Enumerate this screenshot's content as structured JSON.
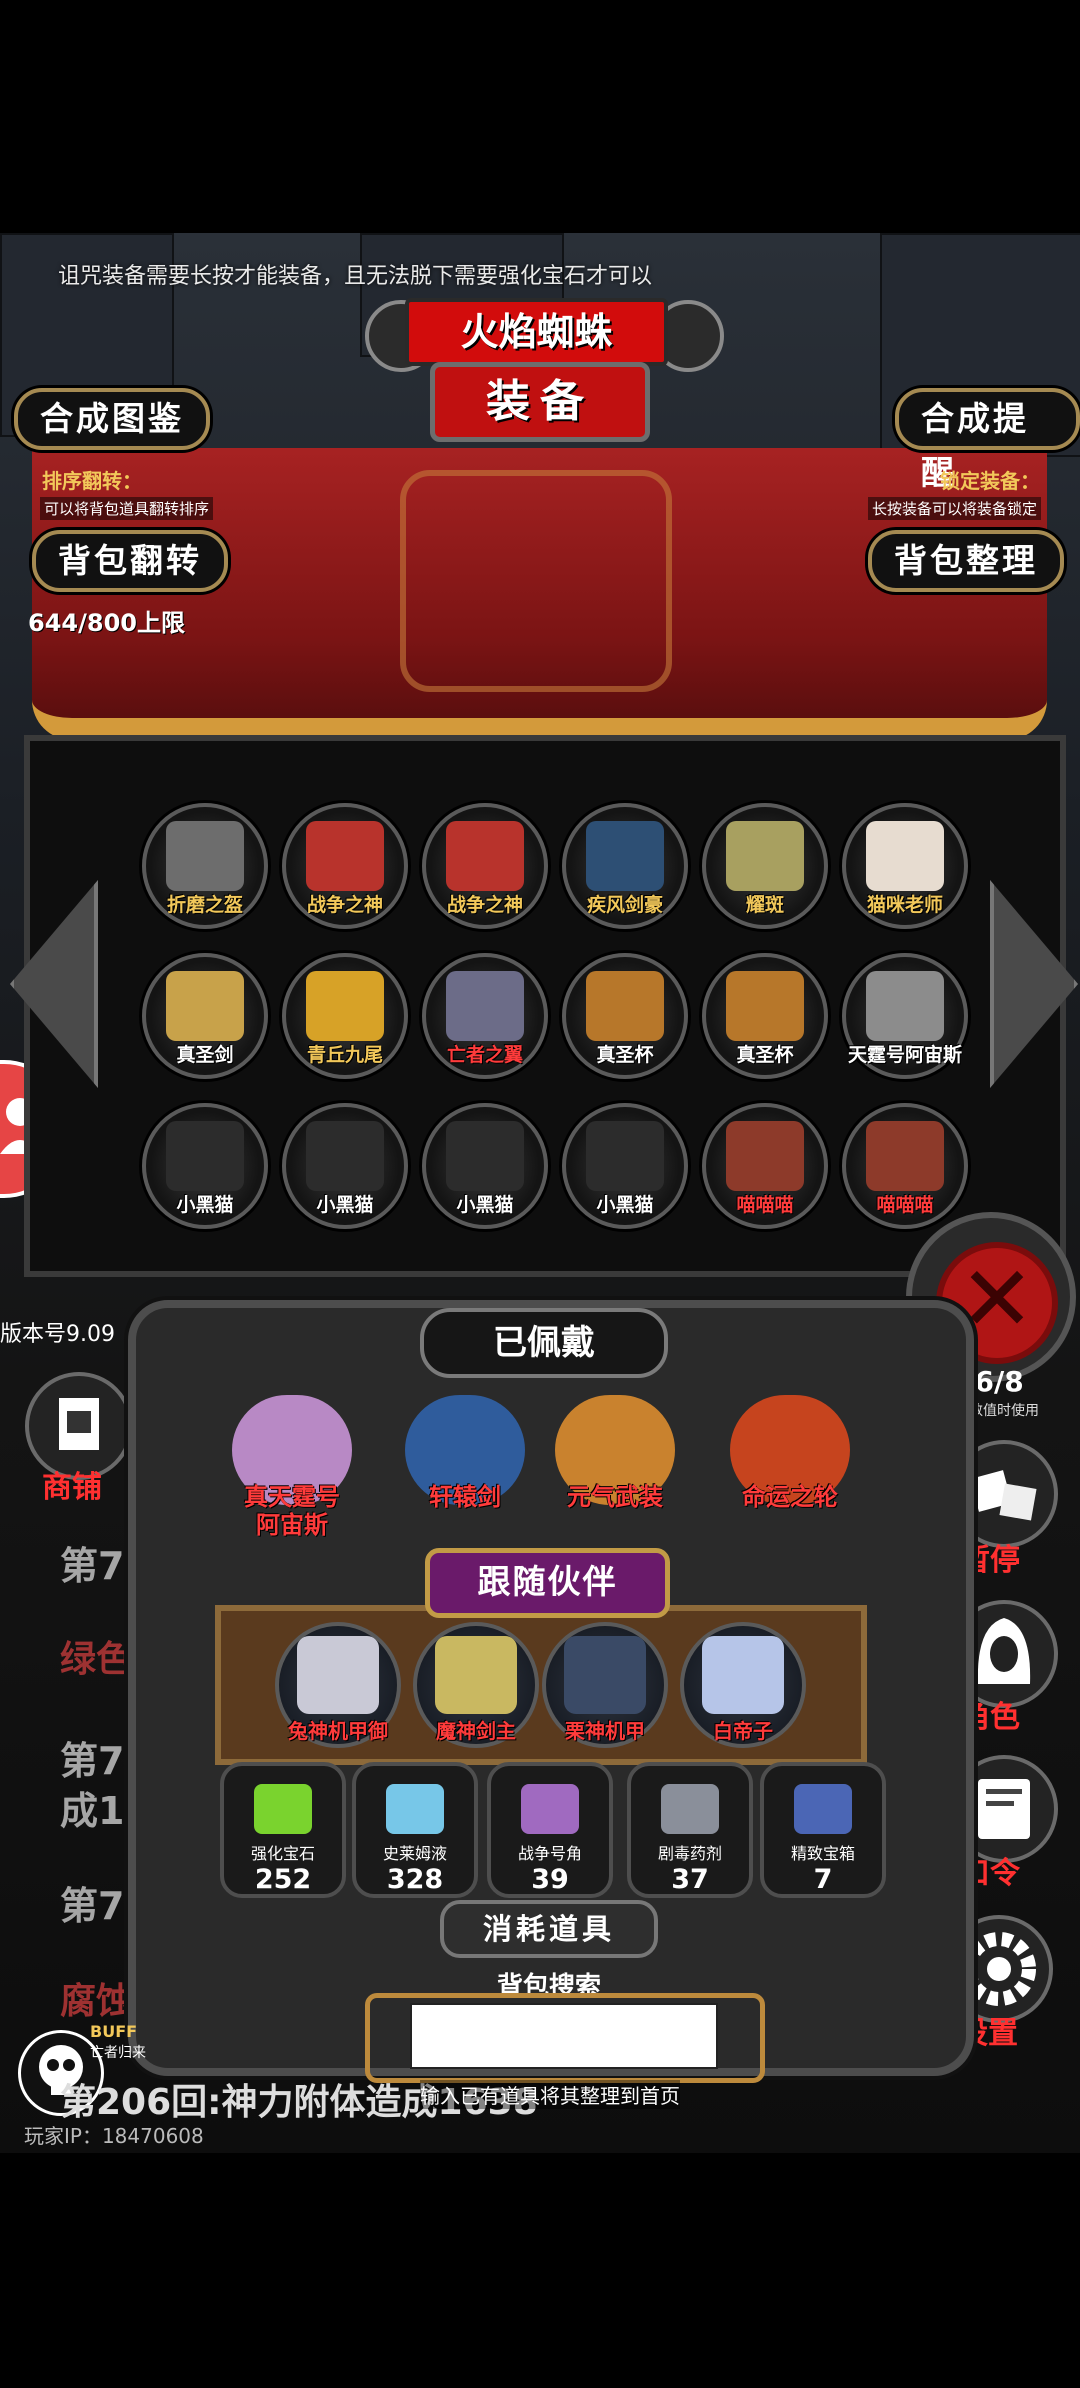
{
  "top_tip": "诅咒装备需要长按才能装备，且无法脱下需要强化宝石才可以",
  "header": {
    "monster_name": "火焰蜘蛛",
    "title": "装备",
    "left_button": "合成图鉴",
    "right_button": "合成提醒"
  },
  "sort_flip": {
    "label": "排序翻转：",
    "hint": "可以将背包道具翻转排序",
    "button": "背包翻转"
  },
  "lock_equip": {
    "label": "锁定装备：",
    "hint": "长按装备可以将装备锁定",
    "button": "背包整理"
  },
  "capacity": "644/800上限",
  "version": "版本号9.09",
  "bag_items": [
    {
      "name": "折磨之盔",
      "style": "gold",
      "color": "#6d6d6d"
    },
    {
      "name": "战争之神",
      "style": "gold",
      "color": "#b8332c"
    },
    {
      "name": "战争之神",
      "style": "gold",
      "color": "#b8332c"
    },
    {
      "name": "疾风剑豪",
      "style": "gold",
      "color": "#2d4f74"
    },
    {
      "name": "耀斑",
      "style": "gold",
      "color": "#a8a060"
    },
    {
      "name": "猫咪老师",
      "style": "gold",
      "color": "#e7dcd0"
    },
    {
      "name": "真圣剑",
      "style": "white",
      "color": "#c8a24a"
    },
    {
      "name": "青丘九尾",
      "style": "gold",
      "color": "#d7a227"
    },
    {
      "name": "亡者之翼",
      "style": "red",
      "color": "#6c6c88"
    },
    {
      "name": "真圣杯",
      "style": "white",
      "color": "#b7772a"
    },
    {
      "name": "真圣杯",
      "style": "white",
      "color": "#b7772a"
    },
    {
      "name": "天霆号阿宙斯",
      "style": "white",
      "color": "#8c8c8c"
    },
    {
      "name": "小黑猫",
      "style": "white",
      "color": "#2c2c2c"
    },
    {
      "name": "小黑猫",
      "style": "white",
      "color": "#2c2c2c"
    },
    {
      "name": "小黑猫",
      "style": "white",
      "color": "#2c2c2c"
    },
    {
      "name": "小黑猫",
      "style": "white",
      "color": "#2c2c2c"
    },
    {
      "name": "喵喵喵",
      "style": "red",
      "color": "#8d3a2a"
    },
    {
      "name": "喵喵喵",
      "style": "red",
      "color": "#8d3a2a"
    }
  ],
  "worn": {
    "title": "已佩戴",
    "items": [
      {
        "name": "真天霆号\n阿宙斯",
        "color": "#b889c5"
      },
      {
        "name": "轩辕剑",
        "color": "#2f5c9c"
      },
      {
        "name": "元气武装",
        "color": "#c9822e"
      },
      {
        "name": "命运之轮",
        "color": "#c6441e"
      }
    ]
  },
  "companions": {
    "title": "跟随伙伴",
    "items": [
      {
        "name": "兔神机甲御",
        "color": "#c9c9d6"
      },
      {
        "name": "魔神剑主",
        "color": "#c9b861"
      },
      {
        "name": "栗神机甲",
        "color": "#3a4a66"
      },
      {
        "name": "白帝子",
        "color": "#b6c5e8"
      }
    ]
  },
  "consumables": {
    "title": "消耗道具",
    "items": [
      {
        "name": "强化宝石",
        "count": "252",
        "color": "#7ad32e"
      },
      {
        "name": "史莱姆液",
        "count": "328",
        "color": "#77c7e8"
      },
      {
        "name": "战争号角",
        "count": "39",
        "color": "#a06ac0"
      },
      {
        "name": "剧毒药剂",
        "count": "37",
        "color": "#8a8f9a"
      },
      {
        "name": "精致宝箱",
        "count": "7",
        "color": "#4b66b5"
      }
    ]
  },
  "search": {
    "label": "背包搜索",
    "value": "",
    "hint": "输入已有道具将其整理到首页"
  },
  "side_menu": {
    "shop": "商铺",
    "pause": "暂停",
    "role": "角色",
    "code": "口令",
    "settings": "设置"
  },
  "side_counter": {
    "value": "76/8",
    "hint": "其数值时使用"
  },
  "buff": {
    "label": "BUFF",
    "sub": "亡者归来"
  },
  "log": {
    "line_round": "第206回:神力附体造成1638",
    "bg_1": "第7",
    "bg_2": "绿色史",
    "bg_3": "第70",
    "bg_4": "成12",
    "bg_5": "第7",
    "bg_6": "腐蚀怪被击败掉落金币"
  },
  "player_ip": "玩家IP：18470608"
}
